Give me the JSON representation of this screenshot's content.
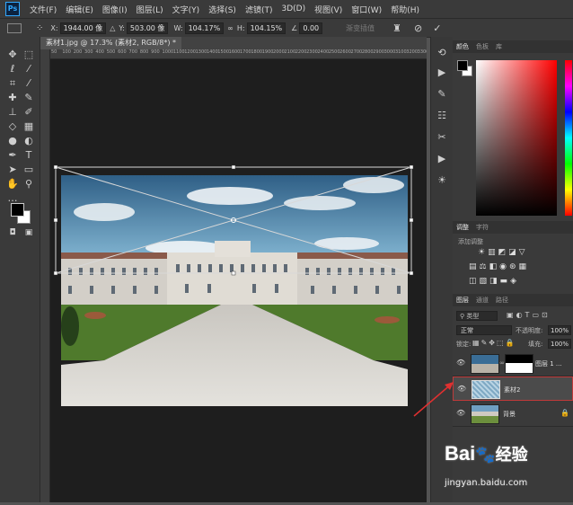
{
  "app": {
    "logo": "Ps"
  },
  "menu": [
    "文件(F)",
    "编辑(E)",
    "图像(I)",
    "图层(L)",
    "文字(Y)",
    "选择(S)",
    "滤镜(T)",
    "3D(D)",
    "视图(V)",
    "窗口(W)",
    "帮助(H)"
  ],
  "options": {
    "x_label": "X:",
    "x_value": "1944.00 像",
    "y_label": "Y:",
    "y_value": "503.00 像",
    "w_label": "W:",
    "w_value": "104.17%",
    "h_label": "H:",
    "h_value": "104.15%",
    "angle_value": "0.00",
    "interp_label": "渐变插值"
  },
  "document": {
    "tab_title": "素材1.jpg @ 17.3% (素材2, RGB/8*) *"
  },
  "ruler": {
    "h_ticks": [
      "50",
      "100",
      "200",
      "300",
      "400",
      "500",
      "600",
      "700",
      "800",
      "900",
      "1000",
      "1100",
      "1200",
      "1300",
      "1400",
      "1500",
      "1600",
      "1700",
      "1800",
      "1900",
      "2000",
      "2100",
      "2200",
      "2300",
      "2400",
      "2500",
      "2600",
      "2700",
      "2800",
      "2900",
      "3000",
      "3100",
      "3200",
      "3300"
    ]
  },
  "color_panel": {
    "tabs": [
      "颜色",
      "色板",
      "库"
    ]
  },
  "adjust_panel": {
    "tabs": [
      "调整",
      "字符"
    ],
    "add_label": "添加调整"
  },
  "layers_panel": {
    "tabs": [
      "图层",
      "通道",
      "路径"
    ],
    "filter_label": "类型",
    "blend_mode": "正常",
    "opacity_label": "不透明度:",
    "opacity_value": "100%",
    "lock_label": "锁定:",
    "fill_label": "填充:",
    "fill_value": "100%",
    "layers": [
      {
        "name": "图层 1 ..."
      },
      {
        "name": "素材2"
      },
      {
        "name": "背景"
      }
    ]
  },
  "watermark": {
    "brand": "Bai",
    "brand2": "经验",
    "url": "jingyan.baidu.com"
  },
  "colors": {
    "accent": "#e03030",
    "panel": "#3a3a3a",
    "canvas": "#1e1e1e"
  }
}
